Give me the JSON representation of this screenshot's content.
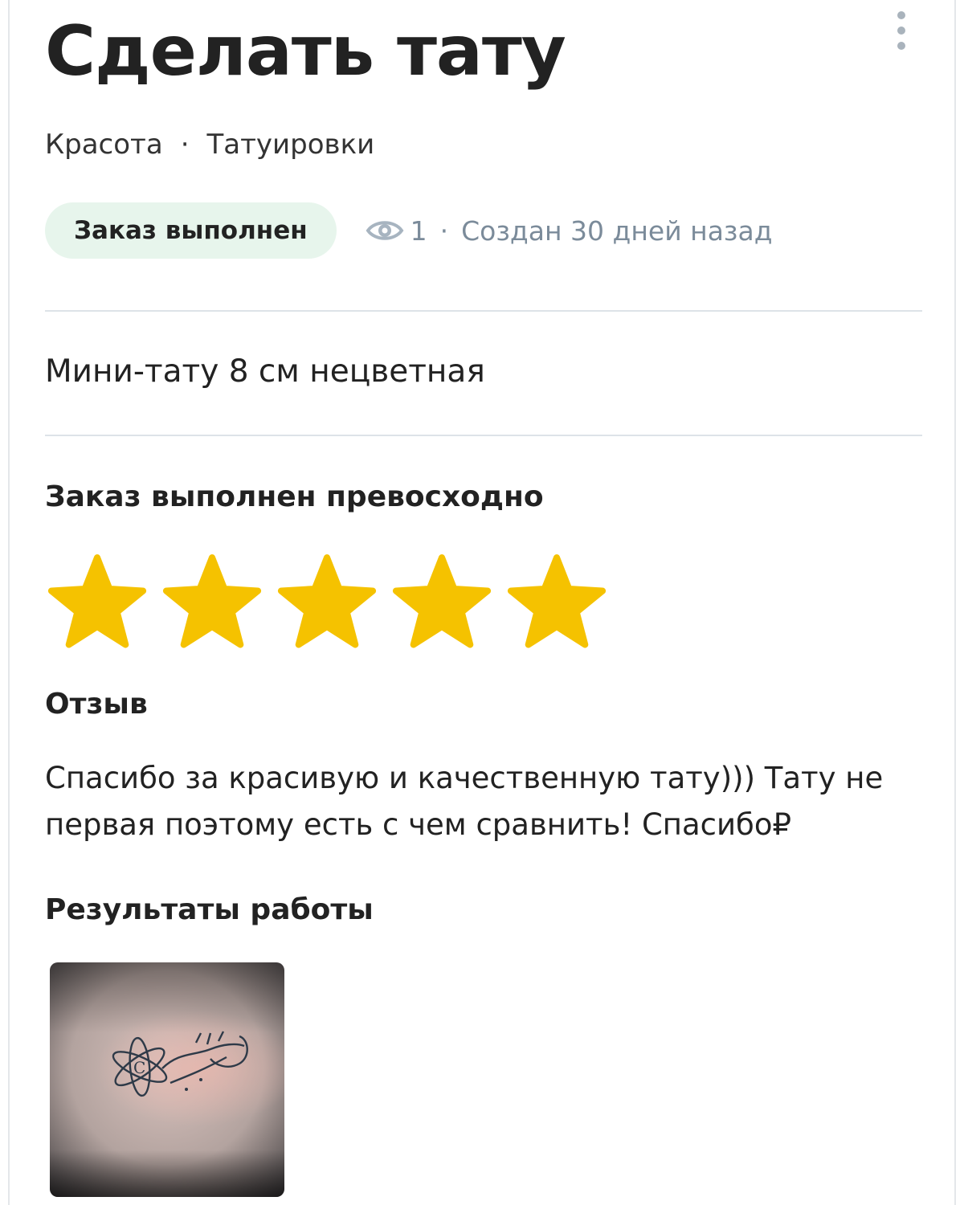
{
  "header": {
    "title": "Сделать тату",
    "more_icon": "more-vertical-icon"
  },
  "breadcrumbs": {
    "category": "Красота",
    "separator": "·",
    "subcategory": "Татуировки"
  },
  "meta": {
    "status": "Заказ выполнен",
    "status_color": "#e7f5ec",
    "views_icon": "eye-icon",
    "views_count": "1",
    "separator": "·",
    "created": "Создан 30 дней назад"
  },
  "order": {
    "description": "Мини-тату 8 см нецветная"
  },
  "rating": {
    "heading": "Заказ выполнен превосходно",
    "stars_filled": 5,
    "stars_total": 5,
    "star_color": "#f5c200"
  },
  "review": {
    "heading": "Отзыв",
    "text_line1": "Спасибо за красивую и качественную тату))) Тату не",
    "text_line2": "первая поэтому есть с чем сравнить! Спасибо₽"
  },
  "results": {
    "heading": "Результаты работы",
    "photo_label": "tattoo-result-photo"
  }
}
